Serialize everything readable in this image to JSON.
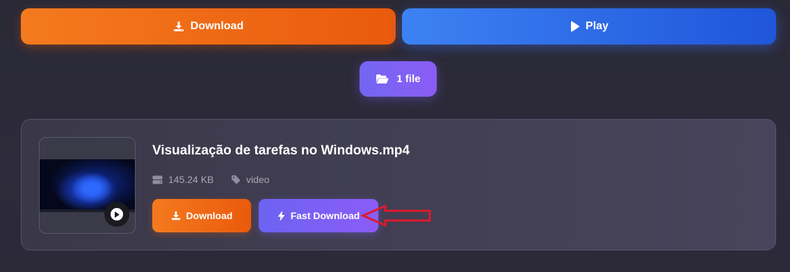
{
  "actions": {
    "download_label": "Download",
    "play_label": "Play"
  },
  "file_count": {
    "label": "1 file"
  },
  "file": {
    "name": "Visualização de tarefas no Windows.mp4",
    "size": "145.24 KB",
    "type": "video",
    "download_label": "Download",
    "fast_download_label": "Fast Download"
  },
  "icons": {
    "download": "download-icon",
    "play": "play-icon",
    "folder": "folder-open-icon",
    "storage": "hard-drive-icon",
    "tag": "tag-icon",
    "bolt": "bolt-icon"
  },
  "colors": {
    "orange_accent": "#ea5a0c",
    "blue_accent": "#1f55da",
    "purple_accent": "#8b5cf6",
    "annotation_red": "#e0192b",
    "background": "#2b2a37"
  }
}
